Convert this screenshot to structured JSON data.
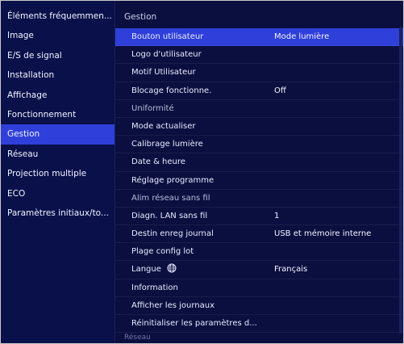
{
  "sidebar": {
    "items": [
      {
        "label": "Éléments fréquemmen..."
      },
      {
        "label": "Image"
      },
      {
        "label": "E/S de signal"
      },
      {
        "label": "Installation"
      },
      {
        "label": "Affichage"
      },
      {
        "label": "Fonctionnement"
      },
      {
        "label": "Gestion"
      },
      {
        "label": "Réseau"
      },
      {
        "label": "Projection multiple"
      },
      {
        "label": "ECO"
      },
      {
        "label": "Paramètres initiaux/to..."
      }
    ]
  },
  "main": {
    "header": "Gestion",
    "rows": [
      {
        "label": "Bouton utilisateur",
        "value": "Mode lumière"
      },
      {
        "label": "Logo d'utilisateur",
        "value": ""
      },
      {
        "label": "Motif Utilisateur",
        "value": ""
      },
      {
        "label": "Blocage fonctionne.",
        "value": "Off"
      },
      {
        "label": "Uniformité",
        "value": ""
      },
      {
        "label": "Mode actualiser",
        "value": ""
      },
      {
        "label": "Calibrage lumière",
        "value": ""
      },
      {
        "label": "Date & heure",
        "value": ""
      },
      {
        "label": "Réglage programme",
        "value": ""
      },
      {
        "label": "Alim réseau sans fil",
        "value": ""
      },
      {
        "label": "Diagn. LAN sans fil",
        "value": "1"
      },
      {
        "label": "Destin enreg journal",
        "value": "USB et mémoire interne"
      },
      {
        "label": "Plage config lot",
        "value": ""
      },
      {
        "label": "Langue",
        "value": "Français"
      },
      {
        "label": "Information",
        "value": ""
      },
      {
        "label": "Afficher les journaux",
        "value": ""
      },
      {
        "label": "Réinitialiser les paramètres d...",
        "value": ""
      }
    ],
    "footer": "Réseau"
  },
  "icons": {
    "language": "globe-icon"
  },
  "colors": {
    "background": "#0b0f3f",
    "sidebar": "#09104a",
    "highlight": "#2f3fd9",
    "text": "#e8ebff"
  }
}
